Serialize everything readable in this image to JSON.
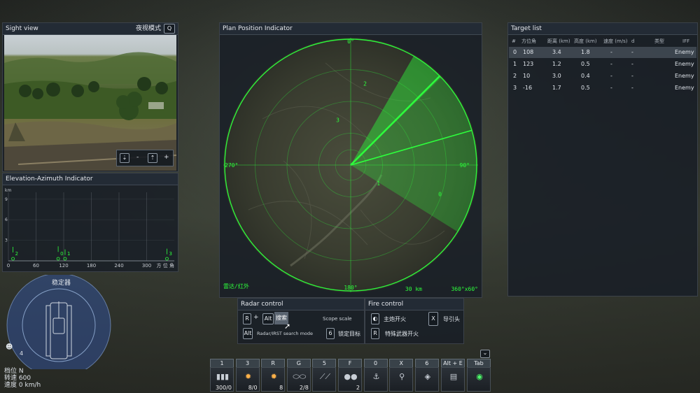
{
  "sight_view": {
    "title": "Sight view",
    "night_mode_label": "夜视模式",
    "night_mode_key": "Q",
    "zoom_minus": "-",
    "zoom_plus": "+"
  },
  "elevation_azimuth": {
    "title": "Elevation-Azimuth Indicator",
    "y_unit": "km",
    "y_ticks": [
      "9",
      "6",
      "3"
    ],
    "x_ticks": [
      "0",
      "60",
      "120",
      "180",
      "240",
      "300"
    ],
    "x_axis_label": "方 位 角",
    "contacts": [
      {
        "id": "2",
        "azimuth": 10,
        "range_km": 3.0
      },
      {
        "id": "0",
        "azimuth": 108,
        "range_km": 3.4
      },
      {
        "id": "1",
        "azimuth": 123,
        "range_km": 1.2
      },
      {
        "id": "3",
        "azimuth": 344,
        "range_km": 1.7
      }
    ]
  },
  "ppi": {
    "title": "Plan Position Indicator",
    "bearing_0": "0°",
    "bearing_90": "90°",
    "bearing_180": "180°",
    "bearing_270": "270°",
    "mode_label": "雷达/红外",
    "range_label": "30 km",
    "scan_label": "360°x60°",
    "contacts": [
      {
        "id": "0",
        "bearing": 108,
        "range_km": 3.4
      },
      {
        "id": "1",
        "bearing": 123,
        "range_km": 1.2
      },
      {
        "id": "2",
        "bearing": 10,
        "range_km": 3.0
      },
      {
        "id": "3",
        "bearing": -16,
        "range_km": 1.7
      }
    ]
  },
  "target_list": {
    "title": "Target list",
    "columns": [
      "#",
      "方位角",
      "距离 (km)",
      "高度 (km)",
      "速度 (m/s)",
      "d",
      "类型",
      "IFF"
    ],
    "rows": [
      {
        "n": "0",
        "azimuth": "108",
        "range": "3.4",
        "alt": "1.8",
        "speed": "-",
        "d": "-",
        "type": "",
        "iff": "Enemy"
      },
      {
        "n": "1",
        "azimuth": "123",
        "range": "1.2",
        "alt": "0.5",
        "speed": "-",
        "d": "-",
        "type": "",
        "iff": "Enemy"
      },
      {
        "n": "2",
        "azimuth": "10",
        "range": "3.0",
        "alt": "0.4",
        "speed": "-",
        "d": "-",
        "type": "",
        "iff": "Enemy"
      },
      {
        "n": "3",
        "azimuth": "-16",
        "range": "1.7",
        "alt": "0.5",
        "speed": "-",
        "d": "-",
        "type": "",
        "iff": "Enemy"
      }
    ]
  },
  "radar_control": {
    "title": "Radar control",
    "key_r": "R",
    "plus": "+",
    "key_alt": "Alt",
    "search_btn": "搜索",
    "scope_scale": "Scope scale",
    "key_alt2": "Alt",
    "search_mode": "Radar/IRST search mode",
    "key_6": "6",
    "lock_target": "锁定目标"
  },
  "fire_control": {
    "title": "Fire control",
    "main_gun": "主炮开火",
    "key_x": "X",
    "seeker": "导引头",
    "key_r": "R",
    "special_weapon": "特殊武器开火"
  },
  "stabilizer": {
    "title": "稳定器",
    "crew_count": "4",
    "gear_label": "档位",
    "gear_value": "N",
    "rpm_label": "转速",
    "rpm_value": "600",
    "speed_label": "速度",
    "speed_value": "0 km/h"
  },
  "weapon_bar": {
    "expand": "⌄",
    "slots": [
      {
        "key": "1",
        "count": "300/0"
      },
      {
        "key": "3",
        "count": "8/0"
      },
      {
        "key": "R",
        "count": "8"
      },
      {
        "key": "G",
        "count": "2/8"
      },
      {
        "key": "5",
        "count": ""
      },
      {
        "key": "F",
        "count": "2"
      },
      {
        "key": "0",
        "count": ""
      },
      {
        "key": "X",
        "count": ""
      },
      {
        "key": "6",
        "count": ""
      },
      {
        "key": "Alt + E",
        "count": ""
      },
      {
        "key": "Tab",
        "count": ""
      }
    ]
  },
  "colors": {
    "radar_green": "#2dff3c",
    "panel_bg": "#181e26",
    "enemy": "#dfe4ea"
  }
}
